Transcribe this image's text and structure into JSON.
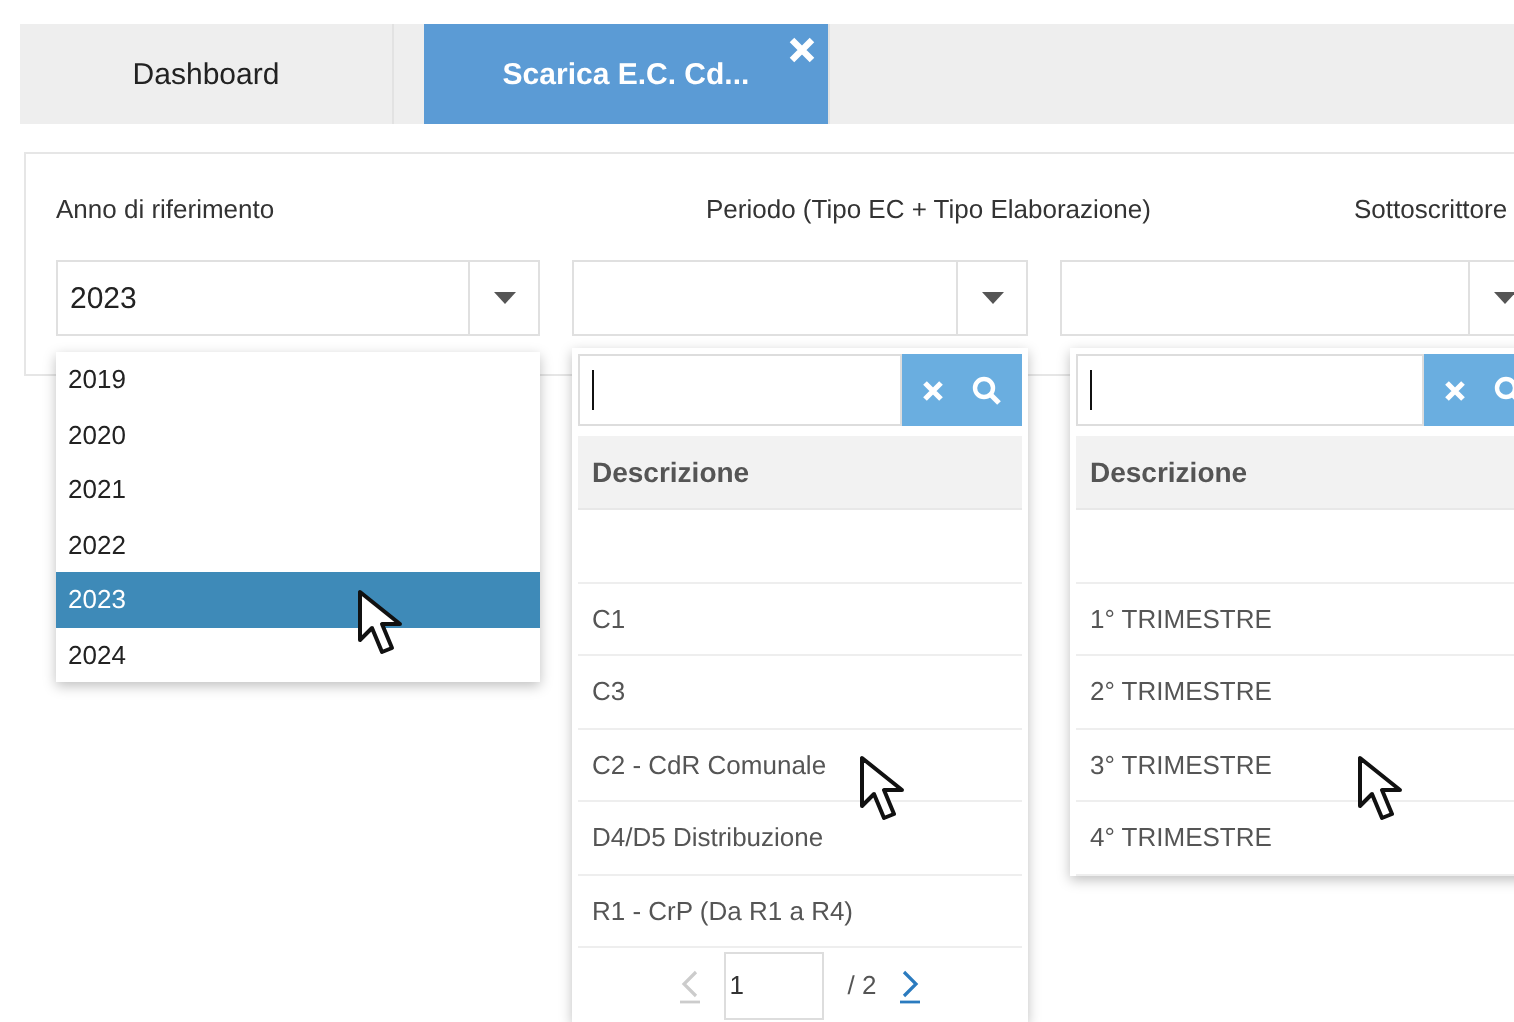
{
  "tabs": [
    {
      "label": "Dashboard",
      "selected": false,
      "closable": false
    },
    {
      "label": "Scarica E.C. Cd...",
      "selected": true,
      "closable": true
    }
  ],
  "filters": [
    {
      "label": "Anno di riferimento",
      "value": "2023"
    },
    {
      "label": "Periodo (Tipo EC + Tipo Elaborazione)"
    },
    {
      "label": "Sottoscrittore"
    }
  ],
  "year_list": [
    {
      "label": "2019",
      "selected": false,
      "pointer": false
    },
    {
      "label": "2020",
      "selected": false,
      "pointer": false
    },
    {
      "label": "2021",
      "selected": false,
      "pointer": false
    },
    {
      "label": "2022",
      "selected": false,
      "pointer": false
    },
    {
      "label": "2023",
      "selected": true,
      "pointer": true
    },
    {
      "label": "2024",
      "selected": false,
      "pointer": false
    }
  ],
  "lookups": [
    {
      "header": "Descrizione",
      "rows": [
        {
          "kind": "blank",
          "pointer": false
        },
        {
          "kind": "option",
          "text": "C1",
          "pointer": false
        },
        {
          "kind": "option",
          "text": "C3",
          "pointer": false
        },
        {
          "kind": "option",
          "text": "C2 - CdR Comunale",
          "pointer": true
        },
        {
          "kind": "option",
          "text": "D4/D5 Distribuzione",
          "pointer": false
        },
        {
          "kind": "option",
          "text": "R1 - CrP (Da R1 a R4)",
          "pointer": false
        }
      ],
      "pagination": {
        "page": "1",
        "total": "/ 2",
        "prev_disabled": true,
        "next_disabled": false
      }
    },
    {
      "header": "Descrizione",
      "rows": [
        {
          "kind": "blank",
          "pointer": false
        },
        {
          "kind": "option",
          "text": "1° TRIMESTRE",
          "pointer": false
        },
        {
          "kind": "option",
          "text": "2° TRIMESTRE",
          "pointer": false
        },
        {
          "kind": "option",
          "text": "3° TRIMESTRE",
          "pointer": true
        },
        {
          "kind": "option",
          "text": "4° TRIMESTRE",
          "pointer": false
        }
      ]
    }
  ]
}
